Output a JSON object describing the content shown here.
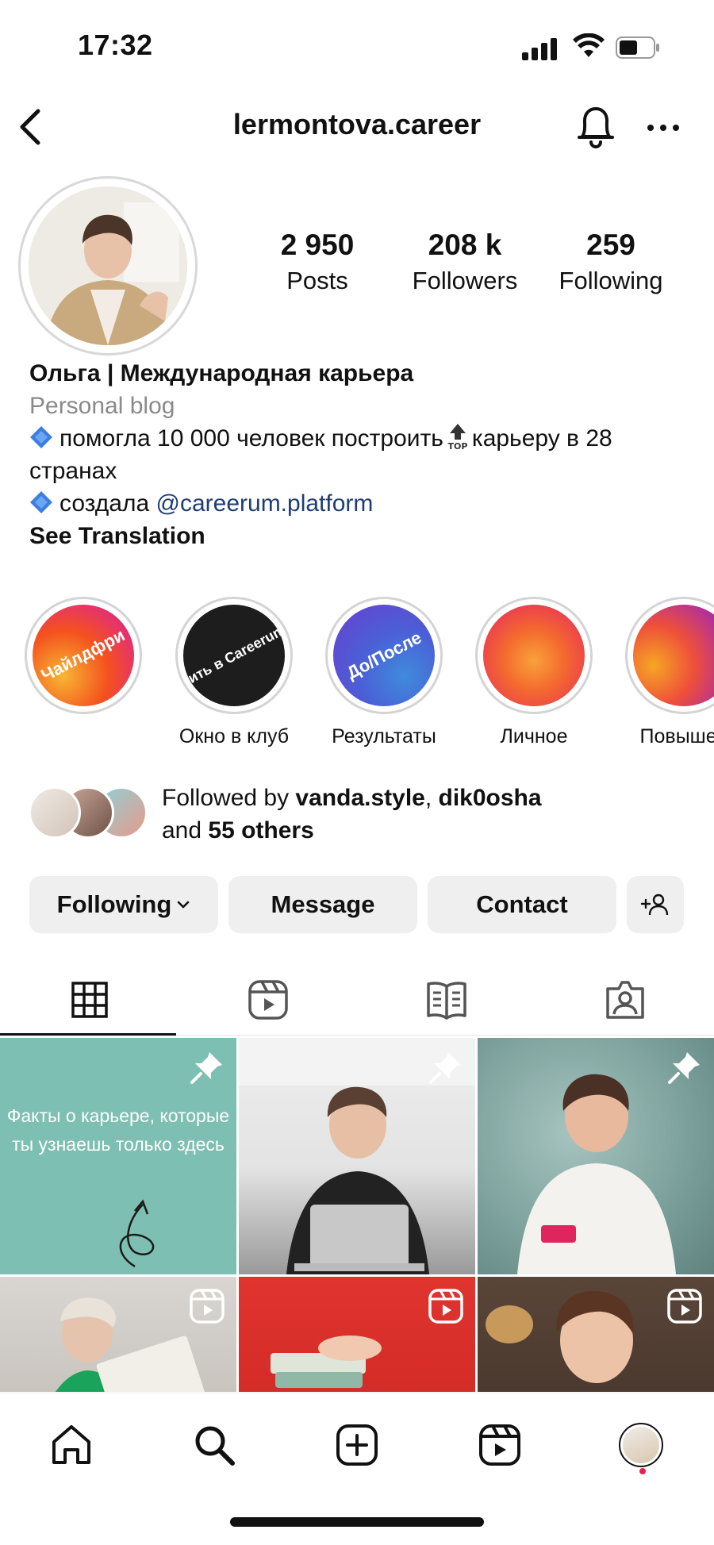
{
  "status_bar": {
    "time": "17:32"
  },
  "header": {
    "username": "lermontova.career"
  },
  "profile": {
    "stats": [
      {
        "value": "2 950",
        "label": "Posts"
      },
      {
        "value": "208 k",
        "label": "Followers"
      },
      {
        "value": "259",
        "label": "Following"
      }
    ],
    "name": "Ольга | Международная карьера",
    "category": "Personal blog",
    "bio_line1_a": "помогла 10 000 человек построить",
    "bio_line1_b": "карьеру в 28 странах",
    "bio_line2_prefix": "создала",
    "bio_link": "@careerum.platform",
    "see_translation": "See Translation"
  },
  "highlights": [
    {
      "label": "",
      "cover_text": "Чайлдфри"
    },
    {
      "label": "Окно в клуб",
      "cover_text": "Вступить в Careerum.Club"
    },
    {
      "label": "Результаты",
      "cover_text": "До/После"
    },
    {
      "label": "Личное",
      "cover_text": ""
    },
    {
      "label": "Повышен",
      "cover_text": ""
    }
  ],
  "followed_by": {
    "prefix": "Followed by",
    "user1": "vanda.style",
    "user2": "dik0osha",
    "and": "and",
    "others": "55 others"
  },
  "actions": {
    "following": "Following",
    "message": "Message",
    "contact": "Contact"
  },
  "posts": {
    "first_post_text": "Факты о карьере, которые ты узнаешь только здесь"
  },
  "colors": {
    "link": "#1f3d72",
    "button_bg": "#efefef",
    "notification_dot": "#e4234b",
    "post_teal": "#7dbfb2"
  },
  "icons": {
    "tabs": [
      "grid-icon",
      "reels-icon",
      "guides-icon",
      "tagged-icon"
    ],
    "bottom_nav": [
      "home-icon",
      "search-icon",
      "create-icon",
      "reels-icon",
      "profile-avatar"
    ]
  }
}
